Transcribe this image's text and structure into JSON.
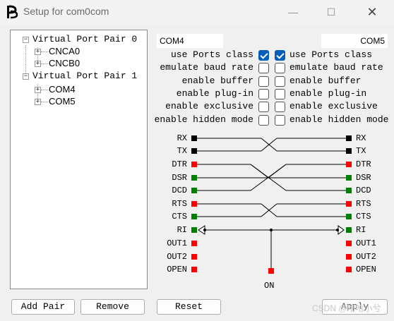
{
  "window": {
    "title": "Setup for com0com",
    "min": "—",
    "max": "☐",
    "close": "✕"
  },
  "tree": {
    "pairs": [
      {
        "label": "Virtual Port Pair 0",
        "children": [
          "CNCA0",
          "CNCB0"
        ]
      },
      {
        "label": "Virtual Port Pair 1",
        "children": [
          "COM4",
          "COM5"
        ]
      }
    ]
  },
  "ports": {
    "left": "COM4",
    "right": "COM5"
  },
  "options": [
    {
      "label": "use Ports class",
      "left_checked": true,
      "right_checked": true
    },
    {
      "label": "emulate baud rate",
      "left_checked": false,
      "right_checked": false
    },
    {
      "label": "enable buffer",
      "left_checked": false,
      "right_checked": false
    },
    {
      "label": "enable plug-in",
      "left_checked": false,
      "right_checked": false
    },
    {
      "label": "enable exclusive",
      "left_checked": false,
      "right_checked": false
    },
    {
      "label": "enable hidden mode",
      "left_checked": false,
      "right_checked": false
    }
  ],
  "signals": {
    "left": [
      {
        "name": "RX",
        "color": "black"
      },
      {
        "name": "TX",
        "color": "black"
      },
      {
        "name": "DTR",
        "color": "red"
      },
      {
        "name": "DSR",
        "color": "green"
      },
      {
        "name": "DCD",
        "color": "green"
      },
      {
        "name": "RTS",
        "color": "red"
      },
      {
        "name": "CTS",
        "color": "green"
      },
      {
        "name": "RI",
        "color": "green"
      },
      {
        "name": "OUT1",
        "color": "red"
      },
      {
        "name": "OUT2",
        "color": "red"
      },
      {
        "name": "OPEN",
        "color": "red"
      }
    ],
    "right": [
      {
        "name": "RX",
        "color": "black"
      },
      {
        "name": "TX",
        "color": "black"
      },
      {
        "name": "DTR",
        "color": "red"
      },
      {
        "name": "DSR",
        "color": "green"
      },
      {
        "name": "DCD",
        "color": "green"
      },
      {
        "name": "RTS",
        "color": "red"
      },
      {
        "name": "CTS",
        "color": "green"
      },
      {
        "name": "RI",
        "color": "green"
      },
      {
        "name": "OUT1",
        "color": "red"
      },
      {
        "name": "OUT2",
        "color": "red"
      },
      {
        "name": "OPEN",
        "color": "red"
      }
    ],
    "on_label": "ON"
  },
  "colors": {
    "black": "#000000",
    "red": "#ff0000",
    "green": "#008000",
    "accent": "#005fb8"
  },
  "buttons": {
    "add_pair": "Add Pair",
    "remove": "Remove",
    "reset": "Reset",
    "apply": "Apply"
  },
  "watermark": "CSDN @哈哈小兮"
}
